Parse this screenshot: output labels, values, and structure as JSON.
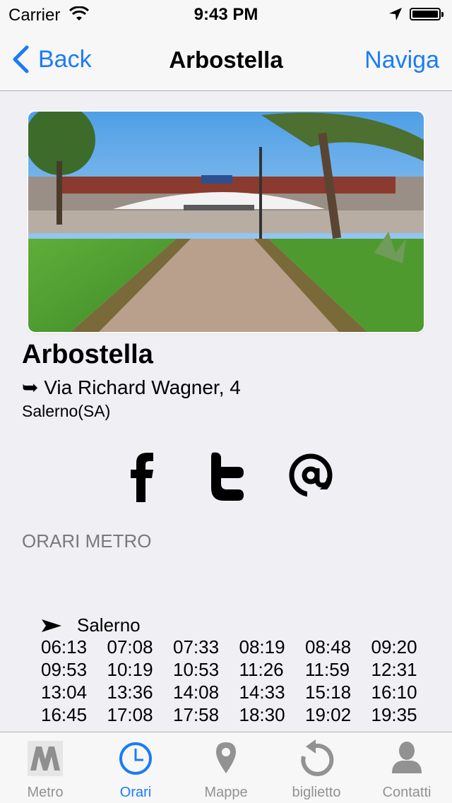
{
  "status_bar": {
    "carrier": "Carrier",
    "time": "9:43 PM"
  },
  "nav": {
    "back_label": "Back",
    "title": "Arbostella",
    "right_label": "Naviga"
  },
  "station": {
    "name": "Arbostella",
    "address": "➥ Via Richard Wagner, 4",
    "city": "Salerno(SA)"
  },
  "social": {
    "icons": [
      "facebook-icon",
      "twitter-icon",
      "email-at-icon"
    ]
  },
  "schedule": {
    "section_title": "ORARI METRO",
    "direction": "Salerno",
    "times": [
      "06:13",
      "07:08",
      "07:33",
      "08:19",
      "08:48",
      "09:20",
      "09:53",
      "10:19",
      "10:53",
      "11:26",
      "11:59",
      "12:31",
      "13:04",
      "13:36",
      "14:08",
      "14:33",
      "15:18",
      "16:10",
      "16:45",
      "17:08",
      "17:58",
      "18:30",
      "19:02",
      "19:35"
    ]
  },
  "tabs": [
    {
      "label": "Metro",
      "icon": "metro-logo-icon",
      "active": false
    },
    {
      "label": "Orari",
      "icon": "clock-icon",
      "active": true
    },
    {
      "label": "Mappe",
      "icon": "map-pin-icon",
      "active": false
    },
    {
      "label": "biglietto",
      "icon": "refresh-icon",
      "active": false
    },
    {
      "label": "Contatti",
      "icon": "person-icon",
      "active": false
    }
  ],
  "colors": {
    "accent": "#1a7cf5",
    "background": "#efeff4",
    "bar": "#f7f7f7",
    "inactive": "#929292"
  }
}
